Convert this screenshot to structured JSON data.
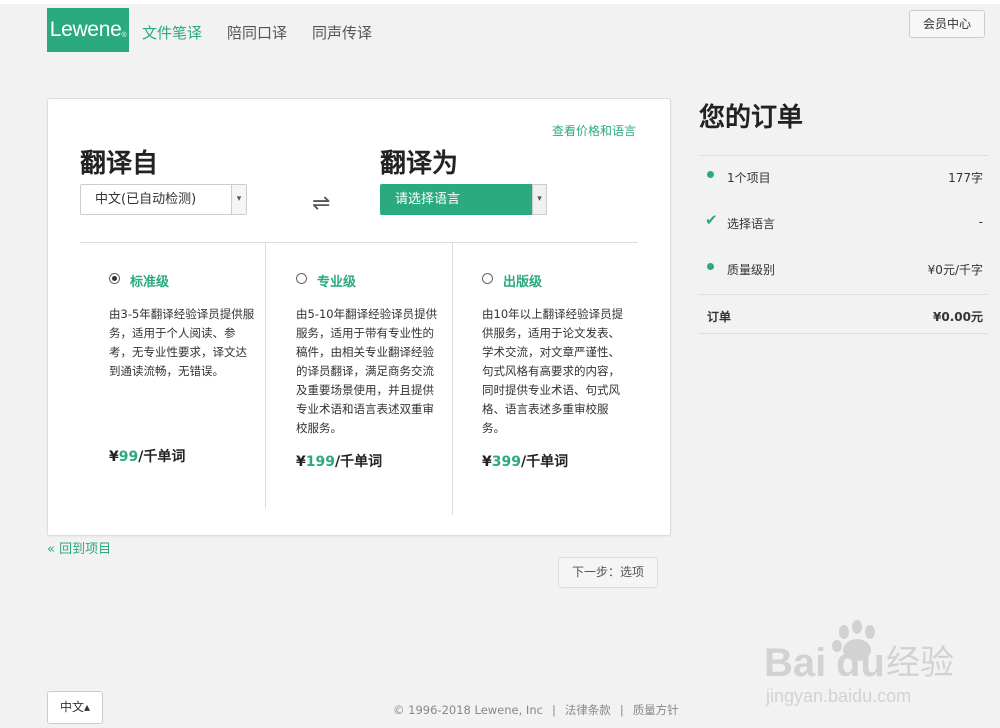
{
  "header": {
    "logo_text": "Lewene",
    "logo_mark": "®",
    "nav": [
      "文件笔译",
      "陪同口译",
      "同声传译"
    ],
    "member_button": "会员中心"
  },
  "translate": {
    "price_link": "查看价格和语言",
    "from_heading": "翻译自",
    "from_value": "中文(已自动检测)",
    "to_heading": "翻译为",
    "to_value": "请选择语言",
    "swap_icon": "⇌",
    "caret": "▾"
  },
  "tiers": [
    {
      "name": "标准级",
      "selected": true,
      "description": "由3-5年翻译经验译员提供服务，适用于个人阅读、参考，无专业性要求，译文达到通读流畅，无错误。",
      "price_prefix": "¥",
      "price_value": "99",
      "price_suffix": "/千单词"
    },
    {
      "name": "专业级",
      "selected": false,
      "description": "由5-10年翻译经验译员提供服务，适用于带有专业性的稿件，由相关专业翻译经验的译员翻译，满足商务交流及重要场景使用，并且提供专业术语和语言表述双重审校服务。",
      "price_prefix": "¥",
      "price_value": "199",
      "price_suffix": "/千单词"
    },
    {
      "name": "出版级",
      "selected": false,
      "description": "由10年以上翻译经验译员提供服务，适用于论文发表、学术交流，对文章严谨性、句式风格有高要求的内容，同时提供专业术语、句式风格、语言表述多重审校服务。",
      "price_prefix": "¥",
      "price_value": "399",
      "price_suffix": "/千单词"
    }
  ],
  "nav_bottom": {
    "back_link": "« 回到项目",
    "next_button": "下一步：选项"
  },
  "order": {
    "title": "您的订单",
    "rows": [
      {
        "label": "1个项目",
        "value": "177字",
        "icon": "dot"
      },
      {
        "label": "选择语言",
        "value": "-",
        "icon": "check"
      },
      {
        "label": "质量级别",
        "value": "¥0元/千字",
        "icon": "dot"
      }
    ],
    "total_label": "订单",
    "total_value": "¥0.00元"
  },
  "footer": {
    "language_button": "中文▴",
    "copyright": "© 1996-2018 Lewene, Inc",
    "links": [
      "法律条款",
      "质量方针"
    ]
  },
  "watermark": {
    "brand": "Bai",
    "brand2": "du",
    "cn": "经验",
    "url": "jingyan.baidu.com"
  },
  "colors": {
    "accent": "#2aaa7e",
    "background": "#f2f2f2"
  }
}
